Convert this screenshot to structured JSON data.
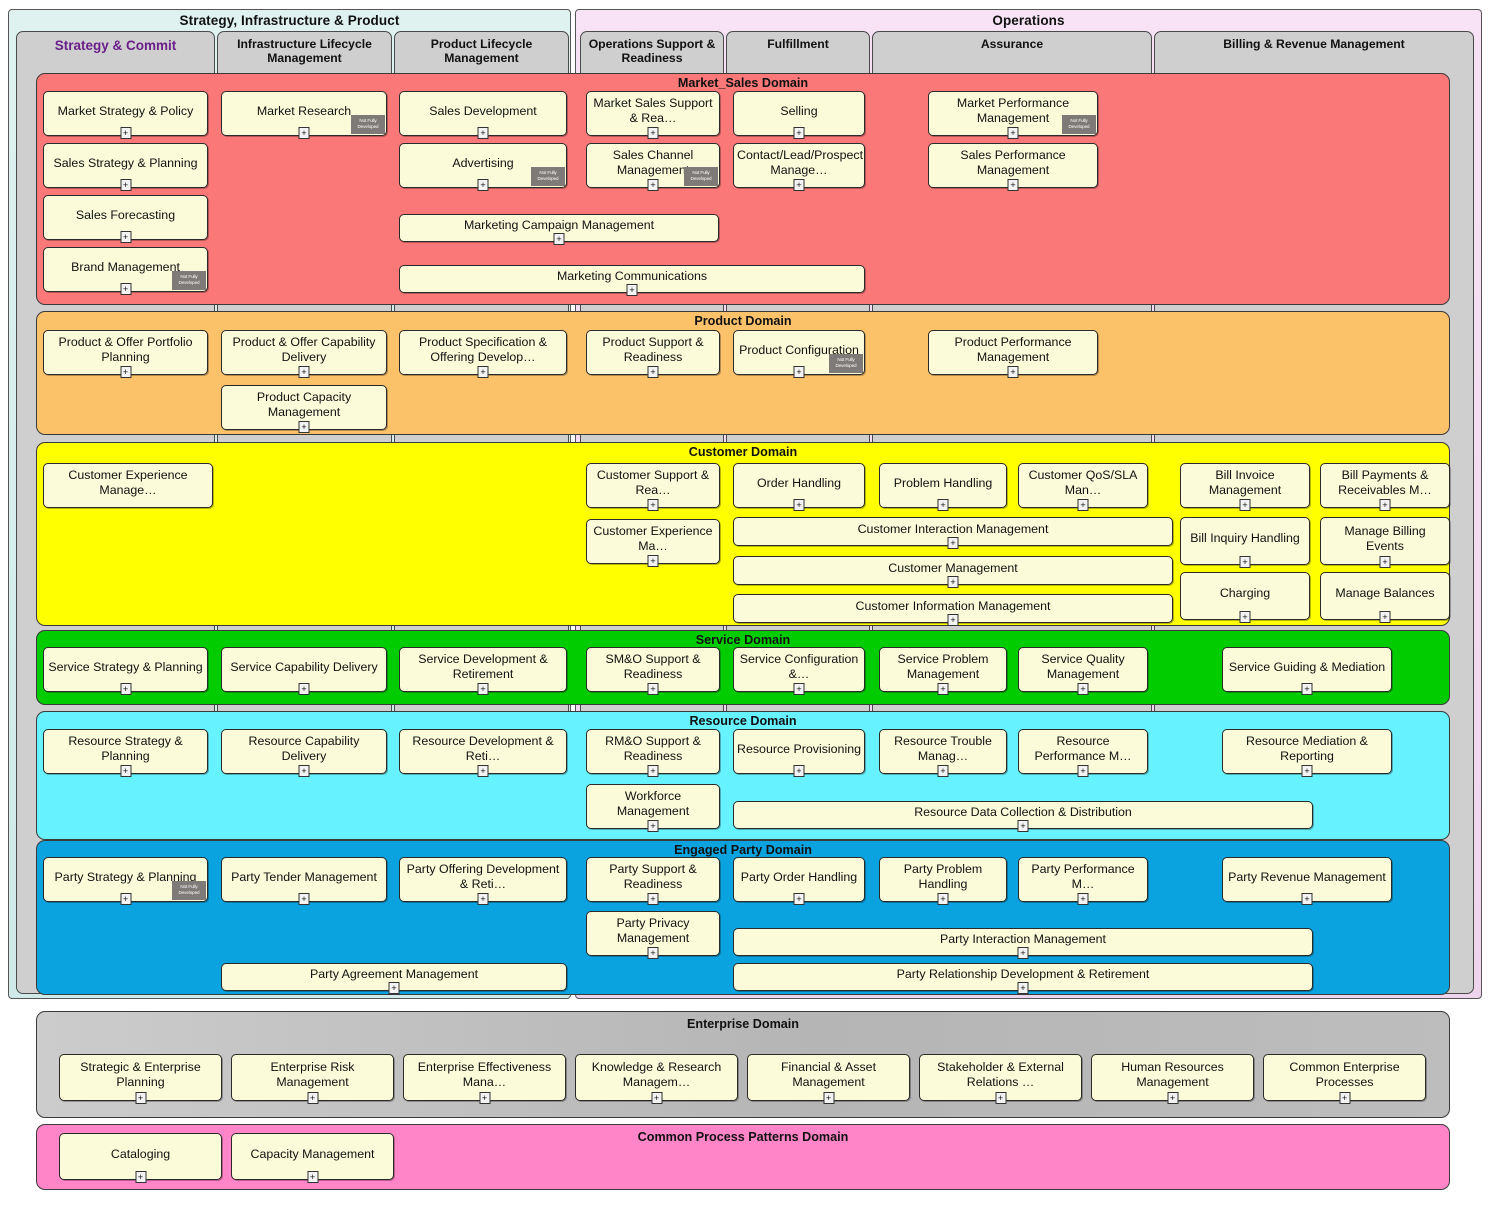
{
  "macro_bands": [
    {
      "id": "sip",
      "title": "Strategy, Infrastructure & Product"
    },
    {
      "id": "ops",
      "title": "Operations"
    }
  ],
  "lanes": [
    {
      "id": "strategy-commit",
      "label": "Strategy & Commit",
      "accent": "#6b1f8a"
    },
    {
      "id": "infrastructure-lifecycle-management",
      "label": "Infrastructure Lifecycle Management"
    },
    {
      "id": "product-lifecycle-management",
      "label": "Product Lifecycle Management"
    },
    {
      "id": "operations-support-readiness",
      "label": "Operations Support & Readiness"
    },
    {
      "id": "fulfillment",
      "label": "Fulfillment"
    },
    {
      "id": "assurance",
      "label": "Assurance"
    },
    {
      "id": "billing-revenue-management",
      "label": "Billing & Revenue Management"
    }
  ],
  "badge_label": "Not Fully Developed",
  "expander_glyph": "+",
  "domains": [
    {
      "id": "market-sales",
      "title": "Market_Sales Domain",
      "color": "#fa7878",
      "processes": [
        {
          "label": "Market Strategy & Policy",
          "nfd": false
        },
        {
          "label": "Sales Strategy & Planning",
          "nfd": false
        },
        {
          "label": "Sales Forecasting",
          "nfd": false
        },
        {
          "label": "Brand Management",
          "nfd": true
        },
        {
          "label": "Market Research",
          "nfd": true
        },
        {
          "label": "Sales Development",
          "nfd": false
        },
        {
          "label": "Advertising",
          "nfd": true
        },
        {
          "label": "Marketing Campaign Management",
          "nfd": false
        },
        {
          "label": "Marketing Communications",
          "nfd": false
        },
        {
          "label": "Market Sales Support & Rea…",
          "nfd": false
        },
        {
          "label": "Sales Channel Management",
          "nfd": true
        },
        {
          "label": "Selling",
          "nfd": false
        },
        {
          "label": "Contact/Lead/Prospect Manage…",
          "nfd": false
        },
        {
          "label": "Market Performance Management",
          "nfd": true
        },
        {
          "label": "Sales Performance Management",
          "nfd": false
        }
      ]
    },
    {
      "id": "product",
      "title": "Product Domain",
      "color": "#fbc26a",
      "processes": [
        {
          "label": "Product & Offer Portfolio Planning",
          "nfd": false
        },
        {
          "label": "Product & Offer Capability Delivery",
          "nfd": false
        },
        {
          "label": "Product Capacity Management",
          "nfd": false
        },
        {
          "label": "Product Specification & Offering Develop…",
          "nfd": false
        },
        {
          "label": "Product Support & Readiness",
          "nfd": false
        },
        {
          "label": "Product Configuration",
          "nfd": true
        },
        {
          "label": "Product Performance Management",
          "nfd": false
        }
      ]
    },
    {
      "id": "customer",
      "title": "Customer Domain",
      "color": "#ffff00",
      "processes": [
        {
          "label": "Customer Experience Manage…",
          "nfd": false
        },
        {
          "label": "Customer Support & Rea…",
          "nfd": false
        },
        {
          "label": "Customer Experience Ma…",
          "nfd": false
        },
        {
          "label": "Order Handling",
          "nfd": false
        },
        {
          "label": "Problem Handling",
          "nfd": false
        },
        {
          "label": "Customer QoS/SLA Man…",
          "nfd": false
        },
        {
          "label": "Customer Interaction Management",
          "nfd": false
        },
        {
          "label": "Customer Management",
          "nfd": false
        },
        {
          "label": "Customer Information Management",
          "nfd": false
        },
        {
          "label": "Bill Invoice Management",
          "nfd": false
        },
        {
          "label": "Bill Payments & Receivables M…",
          "nfd": false
        },
        {
          "label": "Bill Inquiry Handling",
          "nfd": false
        },
        {
          "label": "Manage Billing Events",
          "nfd": false
        },
        {
          "label": "Charging",
          "nfd": false
        },
        {
          "label": "Manage Balances",
          "nfd": false
        }
      ]
    },
    {
      "id": "service",
      "title": "Service Domain",
      "color": "#00cc00",
      "processes": [
        {
          "label": "Service Strategy & Planning",
          "nfd": false
        },
        {
          "label": "Service Capability Delivery",
          "nfd": false
        },
        {
          "label": "Service Development & Retirement",
          "nfd": false
        },
        {
          "label": "SM&O Support & Readiness",
          "nfd": false
        },
        {
          "label": "Service Configuration &…",
          "nfd": false
        },
        {
          "label": "Service Problem Management",
          "nfd": false
        },
        {
          "label": "Service Quality Management",
          "nfd": false
        },
        {
          "label": "Service Guiding & Mediation",
          "nfd": false
        }
      ]
    },
    {
      "id": "resource",
      "title": "Resource Domain",
      "color": "#66f2ff",
      "processes": [
        {
          "label": "Resource Strategy & Planning",
          "nfd": false
        },
        {
          "label": "Resource Capability Delivery",
          "nfd": false
        },
        {
          "label": "Resource Development & Reti…",
          "nfd": false
        },
        {
          "label": "RM&O Support & Readiness",
          "nfd": false
        },
        {
          "label": "Workforce Management",
          "nfd": false
        },
        {
          "label": "Resource Provisioning",
          "nfd": false
        },
        {
          "label": "Resource Trouble Manag…",
          "nfd": false
        },
        {
          "label": "Resource Performance M…",
          "nfd": false
        },
        {
          "label": "Resource Mediation & Reporting",
          "nfd": false
        },
        {
          "label": "Resource Data Collection & Distribution",
          "nfd": false
        }
      ]
    },
    {
      "id": "engaged-party",
      "title": "Engaged Party Domain",
      "color": "#0aa3e0",
      "processes": [
        {
          "label": "Party Strategy & Planning",
          "nfd": true
        },
        {
          "label": "Party Tender Management",
          "nfd": false
        },
        {
          "label": "Party Offering Development & Reti…",
          "nfd": false
        },
        {
          "label": "Party Support & Readiness",
          "nfd": false
        },
        {
          "label": "Party Privacy Management",
          "nfd": false
        },
        {
          "label": "Party Order Handling",
          "nfd": false
        },
        {
          "label": "Party Problem Handling",
          "nfd": false
        },
        {
          "label": "Party Performance M…",
          "nfd": false
        },
        {
          "label": "Party Revenue Management",
          "nfd": false
        },
        {
          "label": "Party Agreement Management",
          "nfd": false
        },
        {
          "label": "Party Interaction Management",
          "nfd": false
        },
        {
          "label": "Party Relationship Development & Retirement",
          "nfd": false
        }
      ]
    },
    {
      "id": "enterprise",
      "title": "Enterprise Domain",
      "color": "#bfbfbf",
      "processes": [
        {
          "label": "Strategic & Enterprise Planning",
          "nfd": false
        },
        {
          "label": "Enterprise Risk Management",
          "nfd": false
        },
        {
          "label": "Enterprise Effectiveness Mana…",
          "nfd": false
        },
        {
          "label": "Knowledge & Research Managem…",
          "nfd": false
        },
        {
          "label": "Financial & Asset Management",
          "nfd": false
        },
        {
          "label": "Stakeholder & External Relations …",
          "nfd": false
        },
        {
          "label": "Human Resources Management",
          "nfd": false
        },
        {
          "label": "Common Enterprise Processes",
          "nfd": false
        }
      ]
    },
    {
      "id": "common-process-patterns",
      "title": "Common Process Patterns Domain",
      "color": "#ff84c8",
      "processes": [
        {
          "label": "Cataloging",
          "nfd": false
        },
        {
          "label": "Capacity Management",
          "nfd": false
        }
      ]
    }
  ]
}
